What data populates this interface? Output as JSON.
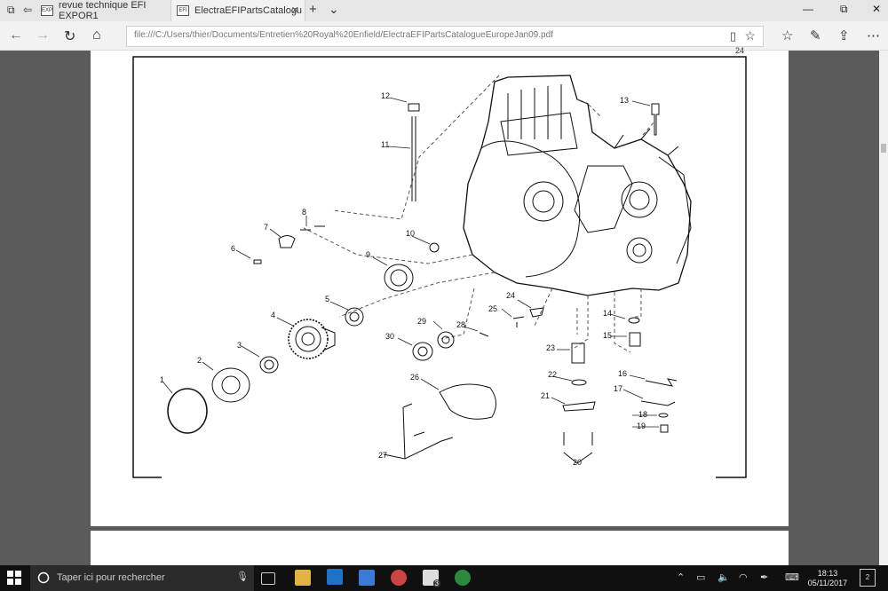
{
  "browser": {
    "tabs": [
      {
        "label": "revue technique EFI EXPOR1",
        "fav": "EXP"
      },
      {
        "label": "ElectraEFIPartsCatalogu",
        "fav": "EFI"
      }
    ],
    "new_tab": "+",
    "tab_list": "⌄",
    "url": "file:///C:/Users/thier/Documents/Entretien%20Royal%20Enfield/ElectraEFIPartsCatalogueEuropeJan09.pdf"
  },
  "document": {
    "page_number": "24",
    "callouts": [
      "1",
      "2",
      "3",
      "4",
      "5",
      "6",
      "7",
      "8",
      "9",
      "10",
      "11",
      "12",
      "13",
      "14",
      "15",
      "16",
      "17",
      "18",
      "19",
      "20",
      "21",
      "22",
      "23",
      "24",
      "25",
      "26",
      "27",
      "28",
      "29",
      "30"
    ]
  },
  "taskbar": {
    "search_placeholder": "Taper ici pour rechercher",
    "time": "18:13",
    "date": "05/11/2017",
    "notif_count": "2",
    "mail_badge": "3"
  }
}
